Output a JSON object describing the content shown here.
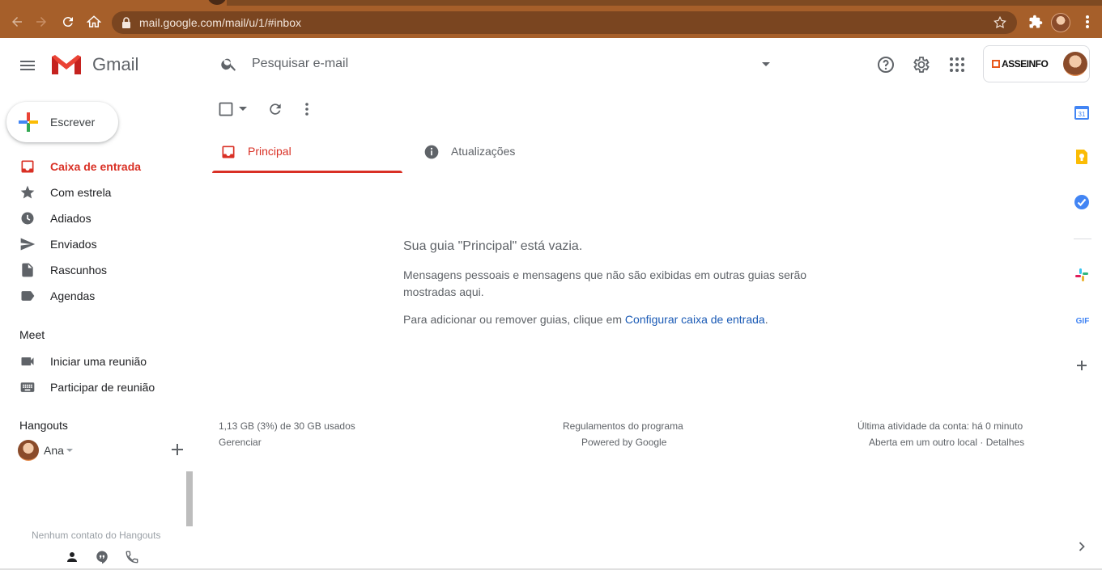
{
  "browser": {
    "url": "mail.google.com/mail/u/1/#inbox"
  },
  "header": {
    "app_name": "Gmail",
    "search_placeholder": "Pesquisar e-mail",
    "account_brand": "ASSEINFO"
  },
  "compose": {
    "label": "Escrever"
  },
  "sidebar": {
    "items": [
      {
        "label": "Caixa de entrada",
        "icon": "inbox-icon",
        "active": true
      },
      {
        "label": "Com estrela",
        "icon": "star-icon"
      },
      {
        "label": "Adiados",
        "icon": "clock-icon"
      },
      {
        "label": "Enviados",
        "icon": "send-icon"
      },
      {
        "label": "Rascunhos",
        "icon": "draft-icon"
      },
      {
        "label": "Agendas",
        "icon": "label-icon"
      }
    ],
    "meet": {
      "title": "Meet",
      "items": [
        {
          "label": "Iniciar uma reunião",
          "icon": "video-icon"
        },
        {
          "label": "Participar de reunião",
          "icon": "keyboard-icon"
        }
      ]
    },
    "hangouts": {
      "title": "Hangouts",
      "user": "Ana",
      "empty_text": "Nenhum contato do Hangouts"
    }
  },
  "tabs": [
    {
      "label": "Principal",
      "icon": "inbox-icon",
      "selected": true
    },
    {
      "label": "Atualizações",
      "icon": "info-icon"
    }
  ],
  "empty_state": {
    "title": "Sua guia \"Principal\" está vazia.",
    "description": "Mensagens pessoais e mensagens que não são exibidas em outras guias serão mostradas aqui.",
    "configure_prefix": "Para adicionar ou remover guias, clique em ",
    "configure_link": "Configurar caixa de entrada",
    "configure_suffix": "."
  },
  "footer": {
    "storage": "1,13 GB (3%) de 30 GB usados",
    "manage": "Gerenciar",
    "program_policies": "Regulamentos do programa",
    "powered_by": "Powered by Google",
    "last_activity": "Última atividade da conta: há 0 minuto",
    "open_elsewhere": "Aberta em um outro local",
    "separator": " · ",
    "details": "Detalhes"
  },
  "side_panel": {
    "calendar_day": "31",
    "gif_label": "GIF"
  },
  "colors": {
    "accent_red": "#d93025",
    "link_blue": "#1a5ab5",
    "chrome_bar": "#a65f2a"
  }
}
